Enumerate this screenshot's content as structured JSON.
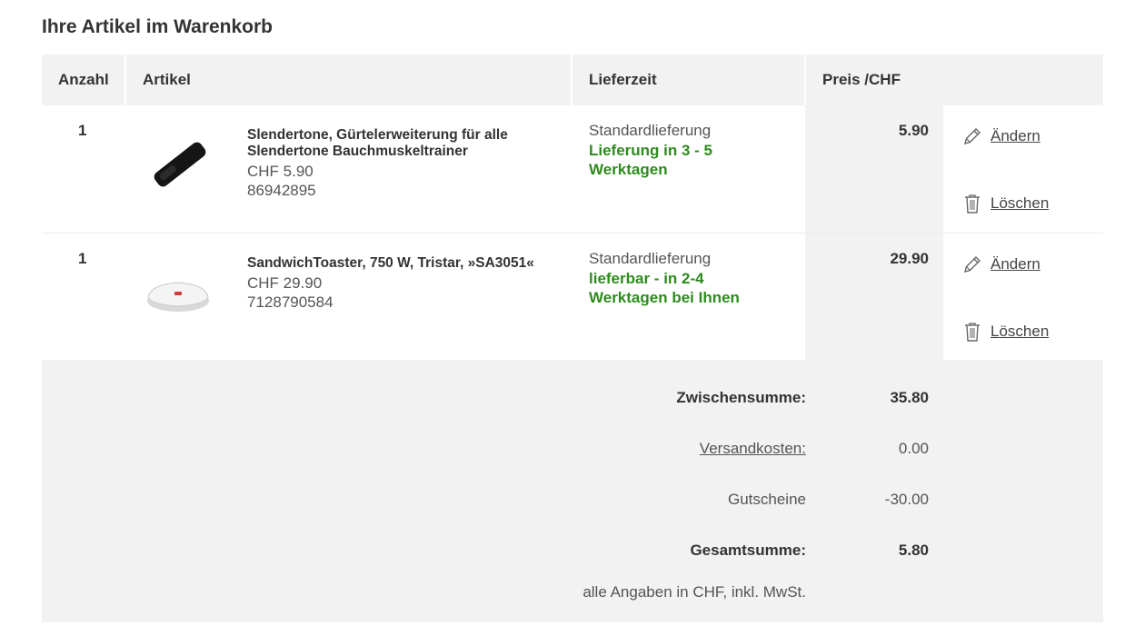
{
  "page": {
    "title": "Ihre Artikel im Warenkorb"
  },
  "table": {
    "headers": {
      "qty": "Anzahl",
      "article": "Artikel",
      "delivery": "Lieferzeit",
      "price": "Preis /CHF"
    }
  },
  "items": [
    {
      "qty": "1",
      "name": "Slendertone, Gürtelerweiterung für alle Slendertone Bauchmuskeltrainer",
      "unit_price": "CHF 5.90",
      "article_no": "86942895",
      "delivery_type": "Standardlieferung",
      "delivery_time": "Lieferung in 3 - 5 Werktagen",
      "price": "5.90",
      "edit_label": "Ändern",
      "delete_label": "Löschen",
      "image_icon": "belt-extension-image"
    },
    {
      "qty": "1",
      "name": "SandwichToaster, 750 W, Tristar, »SA3051«",
      "unit_price": "CHF 29.90",
      "article_no": "7128790584",
      "delivery_type": "Standardlieferung",
      "delivery_time": "lieferbar - in 2-4 Werktagen bei Ihnen",
      "price": "29.90",
      "edit_label": "Ändern",
      "delete_label": "Löschen",
      "image_icon": "sandwich-toaster-image"
    }
  ],
  "summary": {
    "subtotal_label": "Zwischensumme:",
    "subtotal_value": "35.80",
    "shipping_label": "Versandkosten:",
    "shipping_value": "0.00",
    "voucher_label": "Gutscheine",
    "voucher_value": "-30.00",
    "total_label": "Gesamtsumme:",
    "total_value": "5.80",
    "note": "alle Angaben in CHF, inkl. MwSt."
  },
  "colors": {
    "delivery_green": "#2e8b1e",
    "panel_gray": "#f2f2f2"
  }
}
